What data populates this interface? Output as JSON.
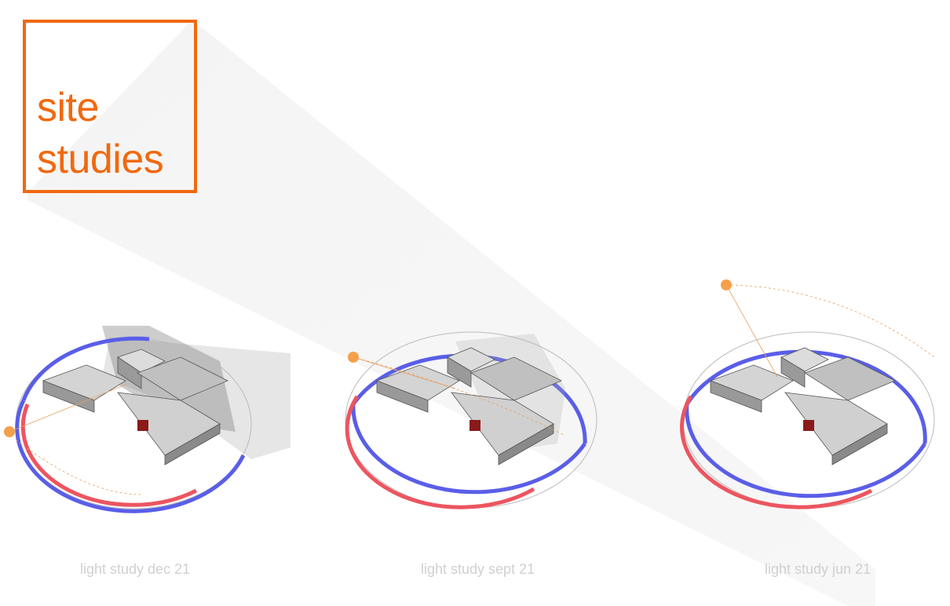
{
  "title": {
    "line1": "site",
    "line2": "studies"
  },
  "studies": [
    {
      "caption": "light study dec 21"
    },
    {
      "caption": "light study sept 21"
    },
    {
      "caption": "light study jun 21"
    }
  ],
  "colors": {
    "accent": "#f0690f",
    "ring_blue": "#5a5ee8",
    "ring_red": "#ec5560",
    "caption": "#d0d0d0",
    "block": "#c8c8c8",
    "highlight": "#8b1a1a"
  }
}
